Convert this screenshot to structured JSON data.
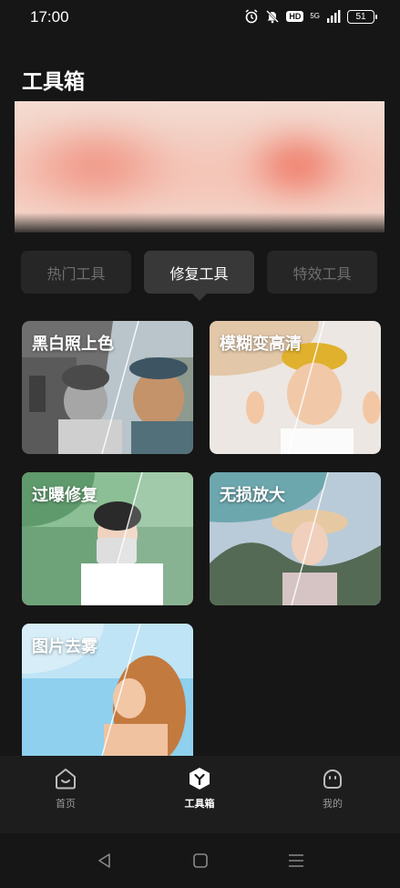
{
  "status_bar": {
    "time": "17:00",
    "hd": "HD",
    "network": "5G",
    "battery": "51"
  },
  "page": {
    "title": "工具箱"
  },
  "tabs": [
    {
      "label": "热门工具",
      "active": false
    },
    {
      "label": "修复工具",
      "active": true
    },
    {
      "label": "特效工具",
      "active": false
    }
  ],
  "tools": [
    {
      "label": "黑白照上色"
    },
    {
      "label": "模糊变高清"
    },
    {
      "label": "过曝修复"
    },
    {
      "label": "无损放大"
    },
    {
      "label": "图片去雾"
    }
  ],
  "bottom_nav": [
    {
      "label": "首页",
      "icon": "home-icon"
    },
    {
      "label": "工具箱",
      "icon": "toolbox-icon"
    },
    {
      "label": "我的",
      "icon": "profile-icon"
    }
  ],
  "colors": {
    "background": "#161616",
    "tab_active": "#383838",
    "tab_inactive": "#262626",
    "highlight_border": "#e0181b"
  }
}
